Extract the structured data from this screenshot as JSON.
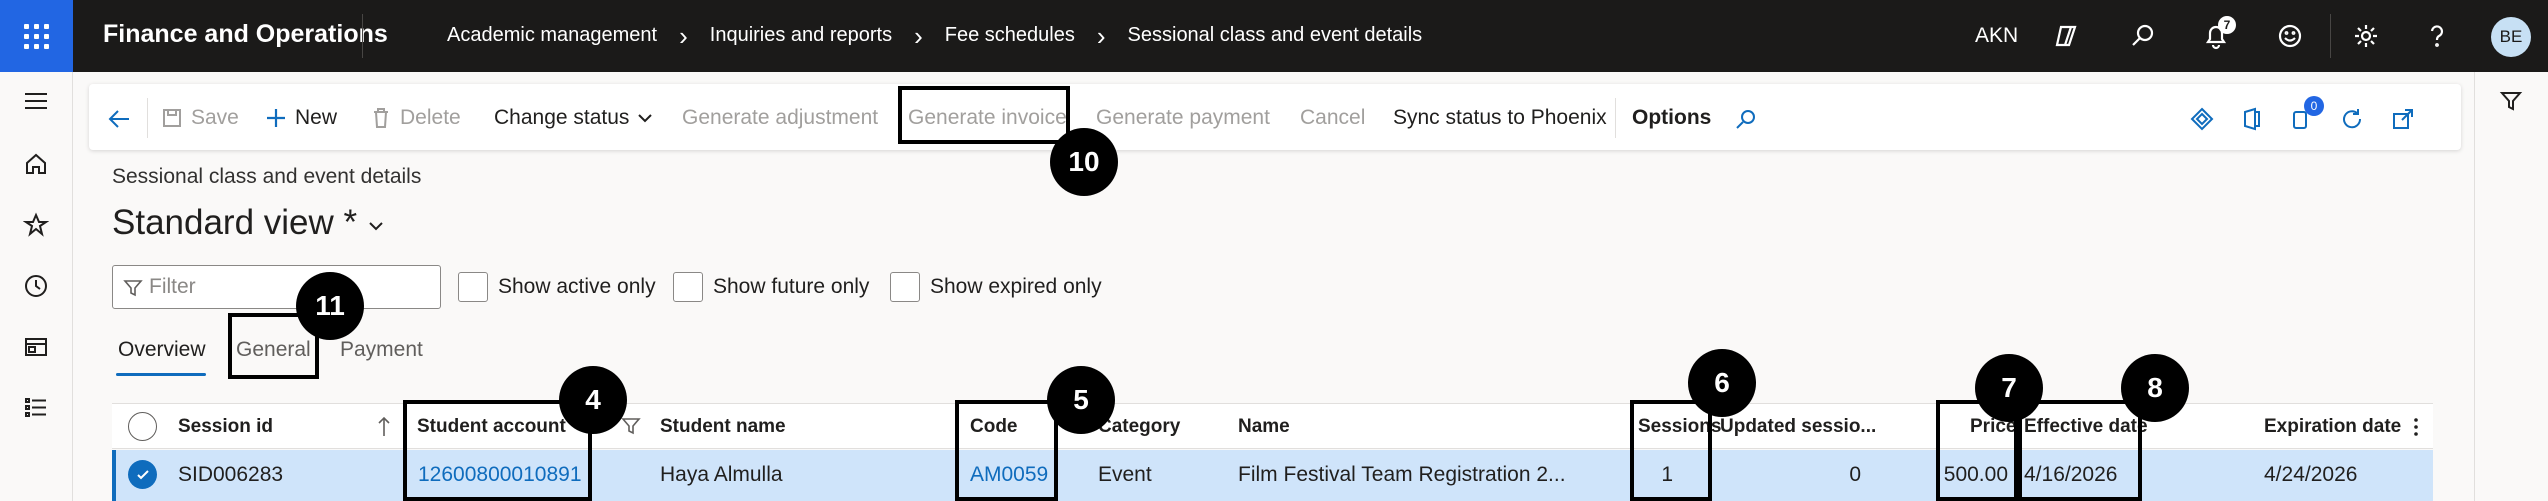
{
  "app": {
    "title": "Finance and Operations",
    "company": "AKN",
    "notification_count": "7",
    "avatar_initials": "BE"
  },
  "breadcrumbs": [
    "Academic management",
    "Inquiries and reports",
    "Fee schedules",
    "Sessional class and event details"
  ],
  "actions": {
    "save": "Save",
    "new": "New",
    "delete": "Delete",
    "change_status": "Change status",
    "generate_adjustment": "Generate adjustment",
    "generate_invoice": "Generate invoice",
    "generate_payment": "Generate payment",
    "cancel": "Cancel",
    "sync_status": "Sync status to Phoenix",
    "options": "Options",
    "attachments_count": "0"
  },
  "page": {
    "caption": "Sessional class and event details",
    "view_title": "Standard view *"
  },
  "filter": {
    "placeholder": "Filter",
    "show_active_only": "Show active only",
    "show_future_only": "Show future only",
    "show_expired_only": "Show expired only"
  },
  "tabs": [
    "Overview",
    "General",
    "Payment"
  ],
  "grid": {
    "columns": [
      "Session id",
      "Student account",
      "Student name",
      "Code",
      "Category",
      "Name",
      "Sessions",
      "Updated sessio...",
      "Price",
      "Effective date",
      "Expiration date"
    ],
    "rows": [
      {
        "session_id": "SID006283",
        "student_account": "12600800010891",
        "student_name": "Haya Almulla",
        "code": "AM0059",
        "category": "Event",
        "name": "Film Festival Team Registration 2...",
        "sessions": "1",
        "updated_sessions": "0",
        "price": "500.00",
        "effective_date": "4/16/2026",
        "expiration_date": "4/24/2026"
      }
    ]
  },
  "callouts": [
    "4",
    "5",
    "6",
    "7",
    "8",
    "10",
    "11"
  ],
  "colors": {
    "topbar": "#1b1a19",
    "waffle": "#2266e3",
    "accent": "#0f6cbd",
    "selected_row": "#cfe4fa"
  }
}
